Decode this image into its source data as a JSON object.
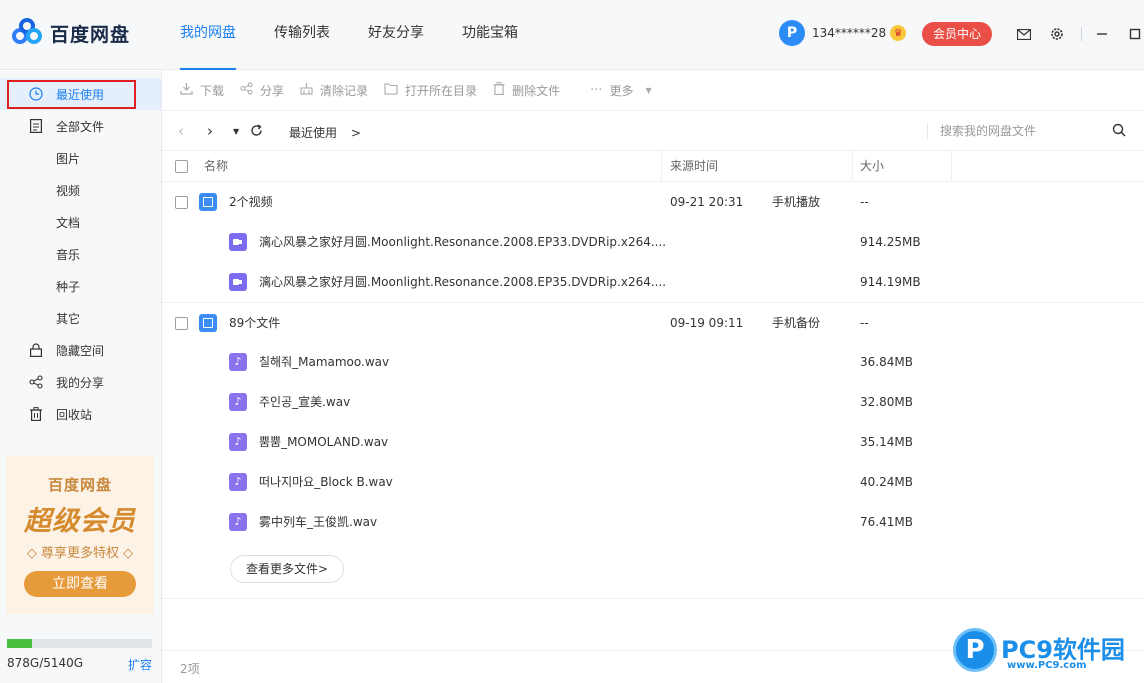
{
  "app": {
    "logo_text": "百度网盘"
  },
  "nav": {
    "tabs": [
      {
        "label": "我的网盘",
        "active": true
      },
      {
        "label": "传输列表",
        "active": false
      },
      {
        "label": "好友分享",
        "active": false
      },
      {
        "label": "功能宝箱",
        "active": false
      }
    ]
  },
  "user": {
    "avatar_letter": "P",
    "name": "134******28",
    "vip_button": "会员中心"
  },
  "header_icons": [
    "mail-icon",
    "settings-icon",
    "minimize-icon",
    "maximize-icon",
    "close-icon"
  ],
  "sidebar": {
    "items": [
      {
        "label": "最近使用",
        "icon": "clock-icon",
        "active": true
      },
      {
        "label": "全部文件",
        "icon": "file-icon"
      },
      {
        "label": "图片"
      },
      {
        "label": "视频"
      },
      {
        "label": "文档"
      },
      {
        "label": "音乐"
      },
      {
        "label": "种子"
      },
      {
        "label": "其它"
      },
      {
        "label": "隐藏空间",
        "icon": "lock-icon"
      },
      {
        "label": "我的分享",
        "icon": "share-icon"
      },
      {
        "label": "回收站",
        "icon": "trash-icon"
      }
    ],
    "promo": {
      "brand": "百度网盘",
      "title": "超级会员",
      "subtitle": "◇ 尊享更多特权 ◇",
      "button": "立即查看"
    },
    "storage": {
      "used_fraction": 0.171,
      "text": "878G/5140G",
      "expand_link": "扩容"
    }
  },
  "toolbar": {
    "download": "下载",
    "share": "分享",
    "clear_history": "清除记录",
    "open_folder": "打开所在目录",
    "delete": "删除文件",
    "more": "更多"
  },
  "address": {
    "breadcrumb": "最近使用",
    "breadcrumb_arrow": ">",
    "search_placeholder": "搜索我的网盘文件"
  },
  "table": {
    "headers": {
      "name": "名称",
      "time": "来源时间",
      "size": "大小"
    },
    "groups": [
      {
        "name": "2个视频",
        "time": "09-21 20:31",
        "source": "手机播放",
        "size": "--",
        "files": [
          {
            "name": "漓心风暴之家好月圆.Moonlight.Resonance.2008.EP33.DVDRip.x264....",
            "size": "914.25MB"
          },
          {
            "name": "漓心风暴之家好月圆.Moonlight.Resonance.2008.EP35.DVDRip.x264....",
            "size": "914.19MB"
          }
        ]
      },
      {
        "name": "89个文件",
        "time": "09-19 09:11",
        "source": "手机备份",
        "size": "--",
        "files": [
          {
            "name": "칠해줘_Mamamoo.wav",
            "size": "36.84MB"
          },
          {
            "name": "주인공_宣美.wav",
            "size": "32.80MB"
          },
          {
            "name": "뿜뿜_MOMOLAND.wav",
            "size": "35.14MB"
          },
          {
            "name": "떠나지마요_Block B.wav",
            "size": "40.24MB"
          },
          {
            "name": "雾中列车_王俊凯.wav",
            "size": "76.41MB"
          }
        ]
      }
    ],
    "more_files_button": "查看更多文件>"
  },
  "footer": {
    "count": "2项"
  },
  "watermark": {
    "logo_letter": "P",
    "text": "PC9软件园",
    "url": "www.PC9.com"
  },
  "colors": {
    "accent": "#1c7ff2",
    "vip": "#e94f46",
    "promo": "#e69a3a",
    "storage": "#47c03b"
  }
}
